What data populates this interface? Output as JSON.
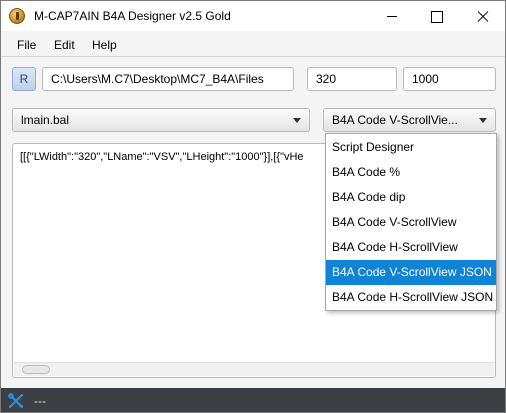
{
  "window": {
    "title": "M-CAP7AIN B4A Designer  v2.5  Gold"
  },
  "menu": {
    "file": "File",
    "edit": "Edit",
    "help": "Help"
  },
  "toolbar": {
    "r_label": "R",
    "path_value": "C:\\Users\\M.C7\\Desktop\\MC7_B4A\\Files",
    "width_value": "320",
    "height_value": "1000"
  },
  "layout_select": {
    "value": "lmain.bal"
  },
  "code_select": {
    "value": "B4A Code V-ScrollVie...",
    "options": [
      "Script Designer",
      "B4A Code %",
      "B4A Code dip",
      "B4A Code V-ScrollView",
      "B4A Code H-ScrollView",
      "B4A Code V-ScrollView JSON",
      "B4A Code H-ScrollView JSON"
    ],
    "highlighted": "B4A Code V-ScrollView JSON"
  },
  "code": {
    "text": "[[{\"LWidth\":\"320\",\"LName\":\"VSV\",\"LHeight\":\"1000\"}],[{\"vHe"
  },
  "status": {
    "text": "---"
  },
  "colors": {
    "accent": "#0f83d6",
    "statusbar": "#3c3f44",
    "icon": "#2f8fd8"
  }
}
